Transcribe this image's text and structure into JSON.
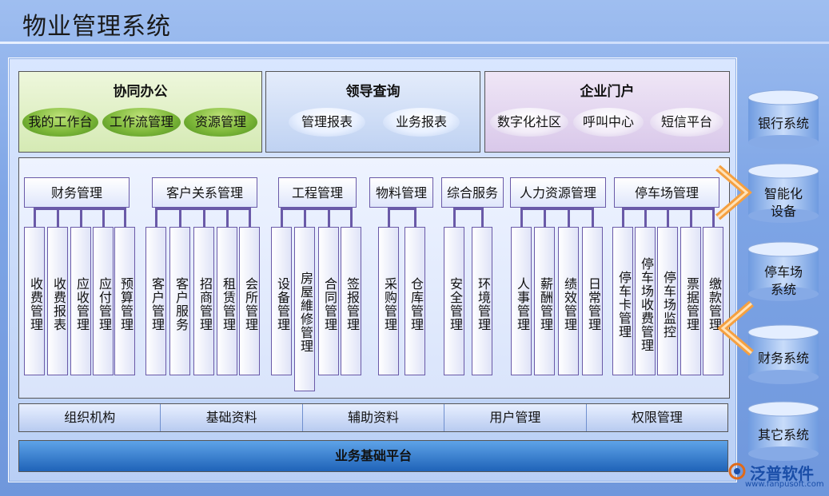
{
  "title": "物业管理系统",
  "top_boxes": [
    {
      "title": "协同办公",
      "items": [
        "我的工作台",
        "工作流管理",
        "资源管理"
      ]
    },
    {
      "title": "领导查询",
      "items": [
        "管理报表",
        "业务报表"
      ]
    },
    {
      "title": "企业门户",
      "items": [
        "数字化社区",
        "呼叫中心",
        "短信平台"
      ]
    }
  ],
  "modules": [
    {
      "name": "财务管理",
      "subs": [
        "收费管理",
        "收费报表",
        "应收管理",
        "应付管理",
        "预算管理"
      ]
    },
    {
      "name": "客户关系管理",
      "subs": [
        "客户管理",
        "客户服务",
        "招商管理",
        "租赁管理",
        "会所管理"
      ]
    },
    {
      "name": "工程管理",
      "subs": [
        "设备管理",
        "房屋維修管理",
        "合同管理",
        "签报管理"
      ]
    },
    {
      "name": "物料管理",
      "subs": [
        "采购管理",
        "仓库管理"
      ]
    },
    {
      "name": "综合服务",
      "subs": [
        "安全管理",
        "环境管理"
      ]
    },
    {
      "name": "人力资源管理",
      "subs": [
        "人事管理",
        "薪酬管理",
        "绩效管理",
        "日常管理"
      ]
    },
    {
      "name": "停车场管理",
      "subs": [
        "停车卡管理",
        "停车场收费管理",
        "停车场监控",
        "票据管理",
        "缴款管理"
      ]
    }
  ],
  "foundation_strip": [
    "组织机构",
    "基础资料",
    "辅助资料",
    "用户管理",
    "权限管理"
  ],
  "platform": "业务基础平台",
  "external_systems": [
    "银行系统",
    "智能化设备",
    "停车场系统",
    "财务系统",
    "其它系统"
  ],
  "logo": {
    "name": "泛普软件",
    "url": "www.fanpusoft.com"
  },
  "colors": {
    "background": "#7ea5e6",
    "line": "#6a5aa8",
    "platform": "#1f63b8",
    "arrow": "#f5a040"
  }
}
